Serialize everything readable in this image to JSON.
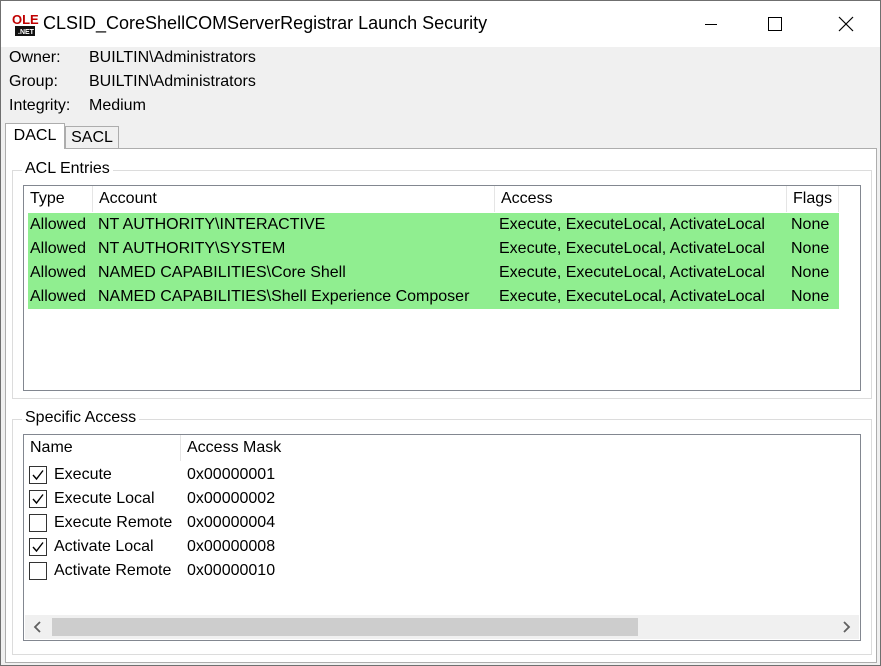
{
  "window": {
    "title": "CLSID_CoreShellCOMServerRegistrar Launch Security",
    "app_icon_text": "OLE",
    "app_icon_subtext": ".NET"
  },
  "info": {
    "owner_label": "Owner:",
    "owner_value": "BUILTIN\\Administrators",
    "group_label": "Group:",
    "group_value": "BUILTIN\\Administrators",
    "integrity_label": "Integrity:",
    "integrity_value": "Medium"
  },
  "tabs": [
    {
      "label": "DACL",
      "active": true
    },
    {
      "label": "SACL",
      "active": false
    }
  ],
  "acl": {
    "group_label": "ACL Entries",
    "columns": [
      "Type",
      "Account",
      "Access",
      "Flags"
    ],
    "rows": [
      [
        "Allowed",
        "NT AUTHORITY\\INTERACTIVE",
        "Execute, ExecuteLocal, ActivateLocal",
        "None"
      ],
      [
        "Allowed",
        "NT AUTHORITY\\SYSTEM",
        "Execute, ExecuteLocal, ActivateLocal",
        "None"
      ],
      [
        "Allowed",
        "NAMED CAPABILITIES\\Core Shell",
        "Execute, ExecuteLocal, ActivateLocal",
        "None"
      ],
      [
        "Allowed",
        "NAMED CAPABILITIES\\Shell Experience Composer",
        "Execute, ExecuteLocal, ActivateLocal",
        "None"
      ]
    ],
    "row_color": "#90ee90"
  },
  "specific": {
    "group_label": "Specific Access",
    "columns": [
      "Name",
      "Access Mask"
    ],
    "rows": [
      {
        "name": "Execute",
        "mask": "0x00000001",
        "checked": true
      },
      {
        "name": "Execute Local",
        "mask": "0x00000002",
        "checked": true
      },
      {
        "name": "Execute Remote",
        "mask": "0x00000004",
        "checked": false
      },
      {
        "name": "Activate Local",
        "mask": "0x00000008",
        "checked": true
      },
      {
        "name": "Activate Remote",
        "mask": "0x00000010",
        "checked": false
      }
    ]
  },
  "icons": {
    "minimize": "minimize-icon",
    "maximize": "maximize-icon",
    "close": "close-icon",
    "scroll_left": "chevron-left-icon",
    "scroll_right": "chevron-right-icon",
    "check": "checkmark-icon"
  }
}
